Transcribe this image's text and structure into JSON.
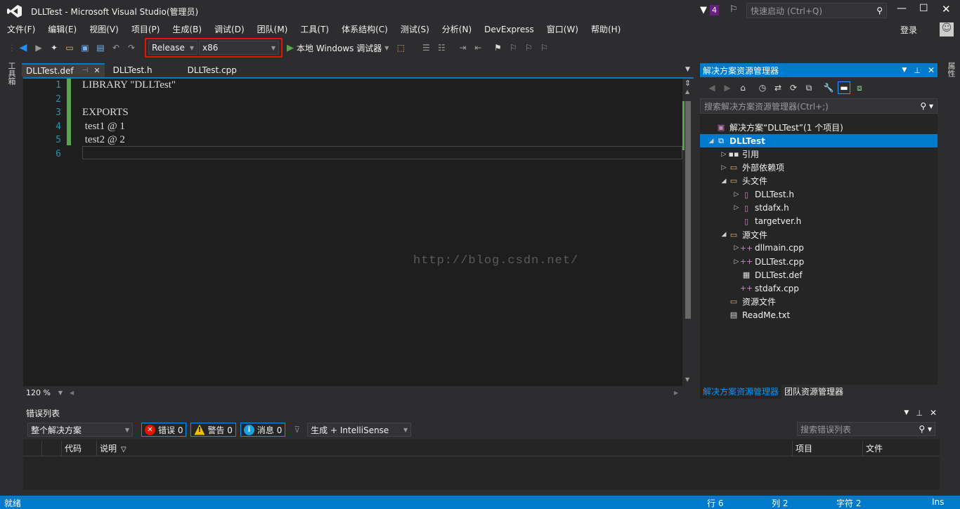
{
  "window": {
    "title": "DLLTest - Microsoft Visual Studio(管理员)",
    "notification_count": "4",
    "quick_launch_placeholder": "快速启动 (Ctrl+Q)",
    "signin_label": "登录"
  },
  "menu": [
    "文件(F)",
    "编辑(E)",
    "视图(V)",
    "项目(P)",
    "生成(B)",
    "调试(D)",
    "团队(M)",
    "工具(T)",
    "体系结构(C)",
    "测试(S)",
    "分析(N)",
    "DevExpress",
    "窗口(W)",
    "帮助(H)"
  ],
  "toolbar": {
    "configuration": "Release",
    "platform": "x86",
    "run_label": "本地 Windows 调试器",
    "highlight_color": "#e51400"
  },
  "left_strip_label": "工具箱",
  "right_strip_label": "属性",
  "doc_tabs": [
    {
      "label": "DLLTest.def",
      "active": true
    },
    {
      "label": "DLLTest.h",
      "active": false
    },
    {
      "label": "DLLTest.cpp",
      "active": false
    }
  ],
  "editor": {
    "lines": [
      "LIBRARY \"DLLTest\"",
      "",
      "EXPORTS",
      " test1 @ 1",
      " test2 @ 2",
      ""
    ],
    "line_numbers": [
      "1",
      "2",
      "3",
      "4",
      "5",
      "6"
    ],
    "watermark": "http://blog.csdn.net/",
    "zoom": "120 %"
  },
  "solution_explorer": {
    "title": "解决方案资源管理器",
    "search_placeholder": "搜索解决方案资源管理器(Ctrl+;)",
    "items": [
      {
        "label": "解决方案“DLLTest”(1 个项目)",
        "depth": 0,
        "twisty": "",
        "icon": "solution-icon",
        "selected": false
      },
      {
        "label": "DLLTest",
        "depth": 0,
        "twisty": "◢",
        "icon": "project-icon",
        "selected": true
      },
      {
        "label": "引用",
        "depth": 1,
        "twisty": "▷",
        "icon": "references-icon",
        "selected": false
      },
      {
        "label": "外部依赖项",
        "depth": 1,
        "twisty": "▷",
        "icon": "folder-icon",
        "selected": false
      },
      {
        "label": "头文件",
        "depth": 1,
        "twisty": "◢",
        "icon": "folder-icon",
        "selected": false
      },
      {
        "label": "DLLTest.h",
        "depth": 2,
        "twisty": "▷",
        "icon": "header-file-icon",
        "selected": false
      },
      {
        "label": "stdafx.h",
        "depth": 2,
        "twisty": "▷",
        "icon": "header-file-icon",
        "selected": false
      },
      {
        "label": "targetver.h",
        "depth": 2,
        "twisty": "",
        "icon": "header-file-icon",
        "selected": false
      },
      {
        "label": "源文件",
        "depth": 1,
        "twisty": "◢",
        "icon": "folder-icon",
        "selected": false
      },
      {
        "label": "dllmain.cpp",
        "depth": 2,
        "twisty": "▷",
        "icon": "cpp-file-icon",
        "selected": false
      },
      {
        "label": "DLLTest.cpp",
        "depth": 2,
        "twisty": "▷",
        "icon": "cpp-file-icon",
        "selected": false
      },
      {
        "label": "DLLTest.def",
        "depth": 2,
        "twisty": "",
        "icon": "def-file-icon",
        "selected": false
      },
      {
        "label": "stdafx.cpp",
        "depth": 2,
        "twisty": "",
        "icon": "cpp-file-icon",
        "selected": false
      },
      {
        "label": "资源文件",
        "depth": 1,
        "twisty": "",
        "icon": "folder-icon",
        "selected": false
      },
      {
        "label": "ReadMe.txt",
        "depth": 1,
        "twisty": "",
        "icon": "text-file-icon",
        "selected": false
      }
    ],
    "tabs": [
      "解决方案资源管理器",
      "团队资源管理器"
    ]
  },
  "error_list": {
    "title": "错误列表",
    "scope": "整个解决方案",
    "errors_label": "错误 0",
    "warnings_label": "警告 0",
    "messages_label": "消息 0",
    "source_filter": "生成 + IntelliSense",
    "search_placeholder": "搜索错误列表",
    "columns": [
      "代码",
      "说明",
      "项目",
      "文件"
    ]
  },
  "statusbar": {
    "state": "就绪",
    "line": "行 6",
    "col": "列 2",
    "char": "字符 2",
    "mode": "Ins"
  }
}
